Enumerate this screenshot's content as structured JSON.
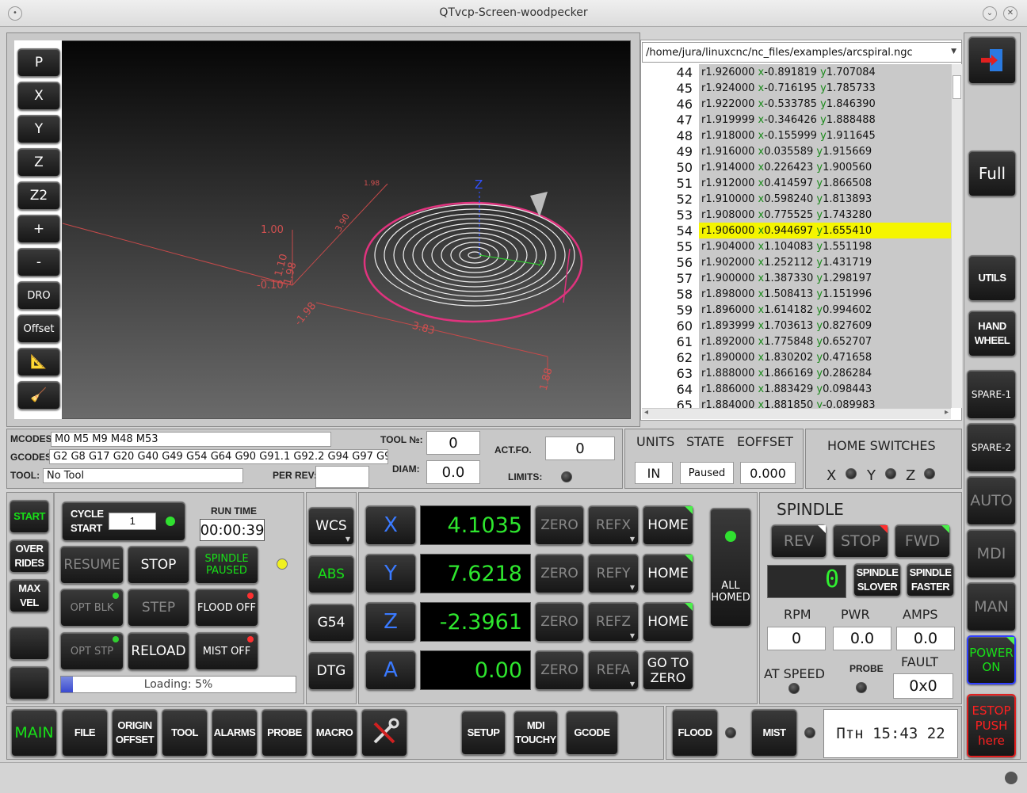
{
  "window": {
    "title": "QTvcp-Screen-woodpecker"
  },
  "view_buttons": [
    "P",
    "X",
    "Y",
    "Z",
    "Z2",
    "+",
    "-",
    "DRO",
    "Offset"
  ],
  "plot": {
    "axis_labels": {
      "z": "Z",
      "x": "X"
    },
    "dims": [
      "1.00",
      "1.10",
      "-1.98",
      "-0.10",
      "-1.98",
      "3.83",
      "1.88",
      "1.98",
      "3.90"
    ]
  },
  "gcode": {
    "file_path": "/home/jura/linuxcnc/nc_files/examples/arcspiral.ngc",
    "lines": [
      {
        "n": "44",
        "r": "r1.926000",
        "x": "x-0.891819",
        "y": "y1.707084"
      },
      {
        "n": "45",
        "r": "r1.924000",
        "x": "x-0.716195",
        "y": "y1.785733"
      },
      {
        "n": "46",
        "r": "r1.922000",
        "x": "x-0.533785",
        "y": "y1.846390"
      },
      {
        "n": "47",
        "r": "r1.919999",
        "x": "x-0.346426",
        "y": "y1.888488"
      },
      {
        "n": "48",
        "r": "r1.918000",
        "x": "x-0.155999",
        "y": "y1.911645"
      },
      {
        "n": "49",
        "r": "r1.916000",
        "x": "x0.035589",
        "y": "y1.915669"
      },
      {
        "n": "50",
        "r": "r1.914000",
        "x": "x0.226423",
        "y": "y1.900560"
      },
      {
        "n": "51",
        "r": "r1.912000",
        "x": "x0.414597",
        "y": "y1.866508"
      },
      {
        "n": "52",
        "r": "r1.910000",
        "x": "x0.598240",
        "y": "y1.813893"
      },
      {
        "n": "53",
        "r": "r1.908000",
        "x": "x0.775525",
        "y": "y1.743280"
      },
      {
        "n": "54",
        "r": "r1.906000",
        "x": "x0.944697",
        "y": "y1.655410",
        "highlight": true
      },
      {
        "n": "55",
        "r": "r1.904000",
        "x": "x1.104083",
        "y": "y1.551198"
      },
      {
        "n": "56",
        "r": "r1.902000",
        "x": "x1.252112",
        "y": "y1.431719"
      },
      {
        "n": "57",
        "r": "r1.900000",
        "x": "x1.387330",
        "y": "y1.298197"
      },
      {
        "n": "58",
        "r": "r1.898000",
        "x": "x1.508413",
        "y": "y1.151996"
      },
      {
        "n": "59",
        "r": "r1.896000",
        "x": "x1.614182",
        "y": "y0.994602"
      },
      {
        "n": "60",
        "r": "r1.893999",
        "x": "x1.703613",
        "y": "y0.827609"
      },
      {
        "n": "61",
        "r": "r1.892000",
        "x": "x1.775848",
        "y": "y0.652707"
      },
      {
        "n": "62",
        "r": "r1.890000",
        "x": "x1.830202",
        "y": "y0.471658"
      },
      {
        "n": "63",
        "r": "r1.888000",
        "x": "x1.866169",
        "y": "y0.286284"
      },
      {
        "n": "64",
        "r": "r1.886000",
        "x": "x1.883429",
        "y": "y0.098443"
      },
      {
        "n": "65",
        "r": "r1.884000",
        "x": "x1.881850",
        "y": "y-0.089983"
      }
    ]
  },
  "right_column": {
    "full": "Full",
    "utils": "UTILS",
    "hand_wheel": "HAND WHEEL",
    "spare1": "SPARE-1",
    "spare2": "SPARE-2",
    "auto": "AUTO",
    "mdi": "MDI",
    "man": "MAN",
    "power_on": "POWER ON",
    "estop": "ESTOP PUSH here"
  },
  "status": {
    "mcodes_label": "MCODES:",
    "mcodes": "M0 M5 M9 M48 M53",
    "gcodes_label": "GCODES:",
    "gcodes": "G2 G8 G17 G20 G40 G49 G54 G64 G90 G91.1 G92.2 G94 G97 G9",
    "tool_label": "TOOL:",
    "tool": "No Tool",
    "tool_no_label": "TOOL №:",
    "tool_no": "0",
    "diam_label": "DIAM:",
    "diam": "0.0",
    "per_rev_label": "PER REV:",
    "per_rev": "",
    "actfo_label": "ACT.FO.",
    "actfo": "0",
    "limits_label": "LIMITS:",
    "units_label": "UNITS",
    "units": "IN",
    "state_label": "STATE",
    "state": "Paused",
    "eoffset_label": "EOFFSET",
    "eoffset": "0.000",
    "home_switches_label": "HOME SWITCHES",
    "hs_x": "X",
    "hs_y": "Y",
    "hs_z": "Z"
  },
  "controls": {
    "start": "START",
    "overrides": "OVER RIDES",
    "max_vel": "MAX VEL",
    "cycle_start": "CYCLE START",
    "cycle_count": "1",
    "run_time_label": "RUN TIME",
    "run_time": "00:00:39",
    "resume": "RESUME",
    "stop": "STOP",
    "spindle_paused": "SPINDLE PAUSED",
    "opt_blk": "OPT BLK",
    "step": "STEP",
    "flood_off": "FLOOD OFF",
    "opt_stp": "OPT STP",
    "reload": "RELOAD",
    "mist_off": "MIST OFF",
    "loading": "Loading: 5%",
    "loading_progress": 5
  },
  "coords": {
    "wcs": "WCS",
    "abs": "ABS",
    "g54": "G54",
    "dtg": "DTG"
  },
  "axes": [
    {
      "name": "X",
      "value": "4.1035",
      "ref": "REFX",
      "home": "HOME"
    },
    {
      "name": "Y",
      "value": "7.6218",
      "ref": "REFY",
      "home": "HOME"
    },
    {
      "name": "Z",
      "value": "-2.3961",
      "ref": "REFZ",
      "home": "HOME"
    },
    {
      "name": "A",
      "value": "0.00",
      "ref": "REFA",
      "home": "GO TO ZERO"
    }
  ],
  "zero_label": "ZERO",
  "all_homed": "ALL HOMED",
  "spindle": {
    "title": "SPINDLE",
    "rev": "REV",
    "stop": "STOP",
    "fwd": "FWD",
    "display": "0",
    "slower": "SPINDLE SLOVER",
    "faster": "SPINDLE FASTER",
    "rpm_label": "RPM",
    "rpm": "0",
    "pwr_label": "PWR",
    "pwr": "0.0",
    "amps_label": "AMPS",
    "amps": "0.0",
    "at_speed": "AT SPEED",
    "probe": "PROBE",
    "fault_label": "FAULT",
    "fault": "0x0"
  },
  "bottom": {
    "main": "MAIN",
    "file": "FILE",
    "origin_offset": "ORIGIN OFFSET",
    "tool": "TOOL",
    "alarms": "ALARMS",
    "probe": "PROBE",
    "macro": "MACRO",
    "setup": "SETUP",
    "mdi_touchy": "MDI TOUCHY",
    "gcode": "GCODE",
    "flood": "FLOOD",
    "mist": "MIST",
    "clock": "Птн 15:43 22"
  }
}
